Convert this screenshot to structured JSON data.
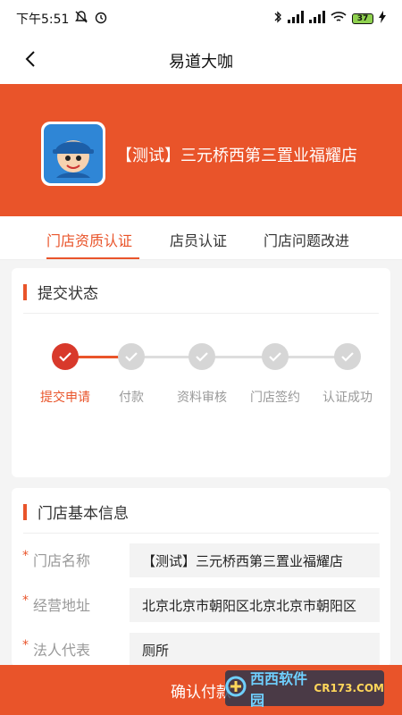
{
  "status_bar": {
    "time": "下午5:51",
    "battery": "37"
  },
  "nav": {
    "title": "易道大咖"
  },
  "banner": {
    "store_name": "【测试】三元桥西第三置业福耀店"
  },
  "tabs": [
    {
      "label": "门店资质认证",
      "active": true
    },
    {
      "label": "店员认证",
      "active": false
    },
    {
      "label": "门店问题改进",
      "active": false
    }
  ],
  "status_card": {
    "title": "提交状态",
    "steps": [
      {
        "label": "提交申请",
        "done": true
      },
      {
        "label": "付款",
        "done": false
      },
      {
        "label": "资料审核",
        "done": false
      },
      {
        "label": "门店签约",
        "done": false
      },
      {
        "label": "认证成功",
        "done": false
      }
    ]
  },
  "info_card": {
    "title": "门店基本信息",
    "fields": [
      {
        "label": "门店名称",
        "value": "【测试】三元桥西第三置业福耀店"
      },
      {
        "label": "经营地址",
        "value": "北京北京市朝阳区北京北京市朝阳区"
      },
      {
        "label": "法人代表",
        "value": "厕所"
      }
    ]
  },
  "bottom": {
    "button_label": "确认付款"
  },
  "watermark": {
    "text": "西西软件园",
    "sub": "CR173.COM"
  },
  "colors": {
    "accent": "#e9542a",
    "step_active": "#d8392b",
    "step_inactive": "#d6d6d6"
  }
}
